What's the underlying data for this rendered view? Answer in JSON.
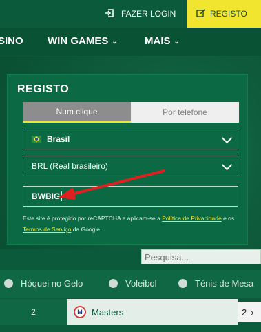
{
  "topbar": {
    "login_label": "FAZER LOGIN",
    "register_label": "REGISTO",
    "login_icon": "sign-in-icon",
    "register_icon": "edit-icon"
  },
  "nav": {
    "items": [
      {
        "label": "SINO"
      },
      {
        "label": "WIN GAMES"
      },
      {
        "label": "MAIS"
      }
    ]
  },
  "modal": {
    "title": "REGISTO",
    "tabs": [
      {
        "label": "Num clique",
        "active": true
      },
      {
        "label": "Por telefone",
        "active": false
      }
    ],
    "country": "Brasil",
    "currency": "BRL (Real brasileiro)",
    "promo_code": "BWBIG",
    "captcha_text_1": "Este site é protegido por reCAPTCHA e aplicam-se a",
    "captcha_link_privacy": "Política de Privacidade",
    "captcha_text_2": "e os",
    "captcha_link_terms": "Termos de Serviço",
    "captcha_text_3": "da Google."
  },
  "search": {
    "placeholder": "Pesquisa..."
  },
  "sports": {
    "items": [
      {
        "label": "Hóquei no Gelo"
      },
      {
        "label": "Voleibol"
      },
      {
        "label": "Ténis de Mesa"
      }
    ]
  },
  "bottom": {
    "left_value": "2",
    "match_name": "Masters",
    "right_value": "2"
  },
  "colors": {
    "accent_yellow": "#f2e52f",
    "brand_green": "#0b5a3b",
    "arrow_red": "#e02020"
  }
}
